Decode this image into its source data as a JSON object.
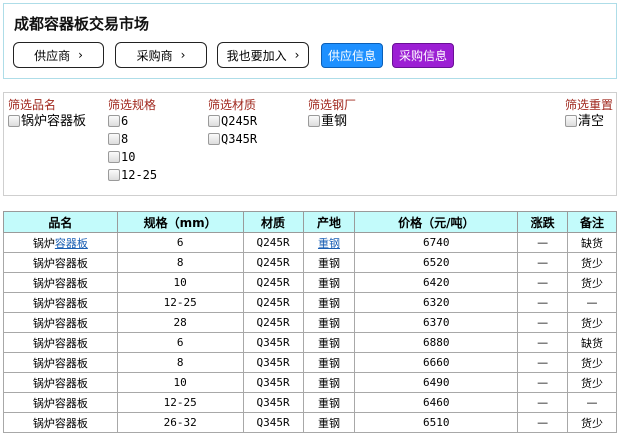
{
  "header": {
    "title": "成都容器板交易市场",
    "nav": [
      {
        "label": "供应商",
        "chevron": "chevron-right-icon"
      },
      {
        "label": "采购商",
        "chevron": "chevron-right-icon"
      },
      {
        "label": "我也要加入",
        "chevron": "chevron-right-icon"
      }
    ],
    "supply_info": "供应信息",
    "purchase_info": "采购信息"
  },
  "filters": {
    "name": {
      "label": "筛选品名",
      "options": [
        "锅炉容器板"
      ]
    },
    "spec": {
      "label": "筛选规格",
      "options": [
        "6",
        "8",
        "10",
        "12-25"
      ]
    },
    "material": {
      "label": "筛选材质",
      "options": [
        "Q245R",
        "Q345R"
      ]
    },
    "mill": {
      "label": "筛选钢厂",
      "options": [
        "重钢"
      ]
    },
    "reset": {
      "label": "筛选重置",
      "options": [
        "清空"
      ]
    }
  },
  "table": {
    "headers": [
      "品名",
      "规格（mm）",
      "材质",
      "产地",
      "价格（元/吨）",
      "涨跌",
      "备注"
    ],
    "rows": [
      {
        "name_a": "锅炉",
        "name_b": "容器板",
        "spec": "6",
        "material": "Q245R",
        "origin": "重钢",
        "price": "6740",
        "change": "—",
        "note": "缺货"
      },
      {
        "name_a": "锅炉",
        "name_b": "容器板",
        "spec": "8",
        "material": "Q245R",
        "origin": "重钢",
        "price": "6520",
        "change": "—",
        "note": "货少"
      },
      {
        "name_a": "锅炉",
        "name_b": "容器板",
        "spec": "10",
        "material": "Q245R",
        "origin": "重钢",
        "price": "6420",
        "change": "—",
        "note": "货少"
      },
      {
        "name_a": "锅炉",
        "name_b": "容器板",
        "spec": "12-25",
        "material": "Q245R",
        "origin": "重钢",
        "price": "6320",
        "change": "—",
        "note": "—"
      },
      {
        "name_a": "锅炉",
        "name_b": "容器板",
        "spec": "28",
        "material": "Q245R",
        "origin": "重钢",
        "price": "6370",
        "change": "—",
        "note": "货少"
      },
      {
        "name_a": "锅炉",
        "name_b": "容器板",
        "spec": "6",
        "material": "Q345R",
        "origin": "重钢",
        "price": "6880",
        "change": "—",
        "note": "缺货"
      },
      {
        "name_a": "锅炉",
        "name_b": "容器板",
        "spec": "8",
        "material": "Q345R",
        "origin": "重钢",
        "price": "6660",
        "change": "—",
        "note": "货少"
      },
      {
        "name_a": "锅炉",
        "name_b": "容器板",
        "spec": "10",
        "material": "Q345R",
        "origin": "重钢",
        "price": "6490",
        "change": "—",
        "note": "货少"
      },
      {
        "name_a": "锅炉",
        "name_b": "容器板",
        "spec": "12-25",
        "material": "Q345R",
        "origin": "重钢",
        "price": "6460",
        "change": "—",
        "note": "—"
      },
      {
        "name_a": "锅炉",
        "name_b": "容器板",
        "spec": "26-32",
        "material": "Q345R",
        "origin": "重钢",
        "price": "6510",
        "change": "—",
        "note": "货少"
      }
    ]
  }
}
